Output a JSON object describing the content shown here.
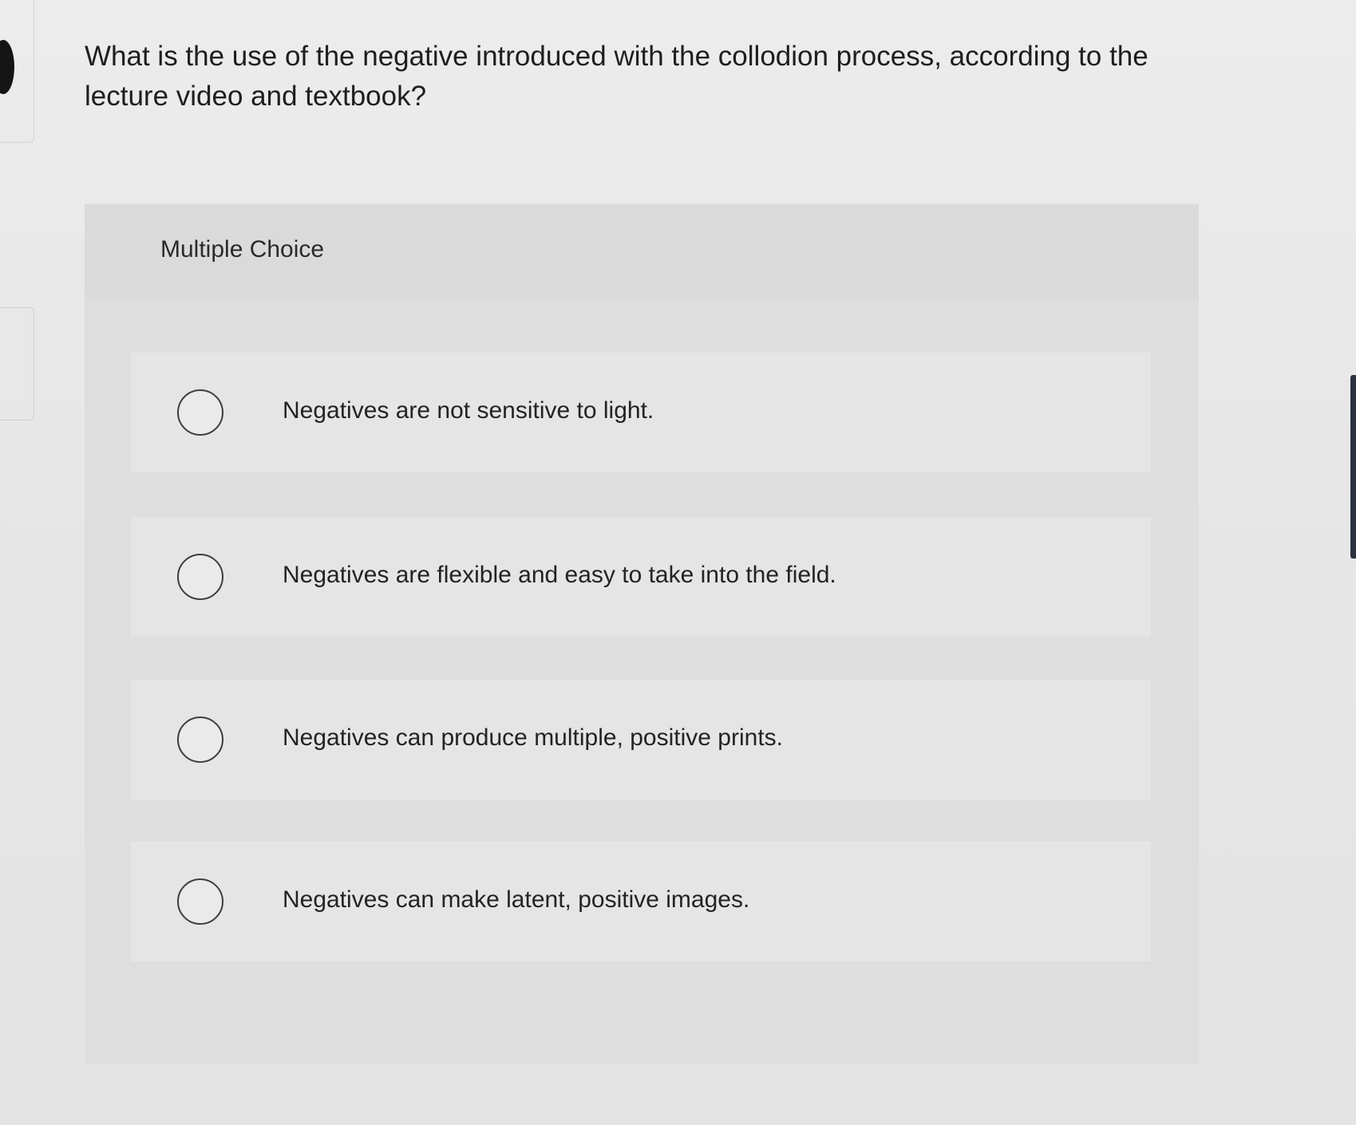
{
  "question": {
    "text": "What is the use of the negative introduced with the collodion process, according to the lecture video and textbook?"
  },
  "card": {
    "title": "Multiple Choice"
  },
  "options": [
    {
      "label": "Negatives are not sensitive to light.",
      "selected": false
    },
    {
      "label": "Negatives are flexible and easy to take into the field.",
      "selected": false
    },
    {
      "label": "Negatives can produce multiple, positive prints.",
      "selected": false
    },
    {
      "label": "Negatives can make latent, positive images.",
      "selected": false
    }
  ],
  "colors": {
    "text": "#1e1e1e",
    "card_background": "#dedede",
    "option_background": "#e5e5e5",
    "radio_border": "#3d3d3d"
  }
}
